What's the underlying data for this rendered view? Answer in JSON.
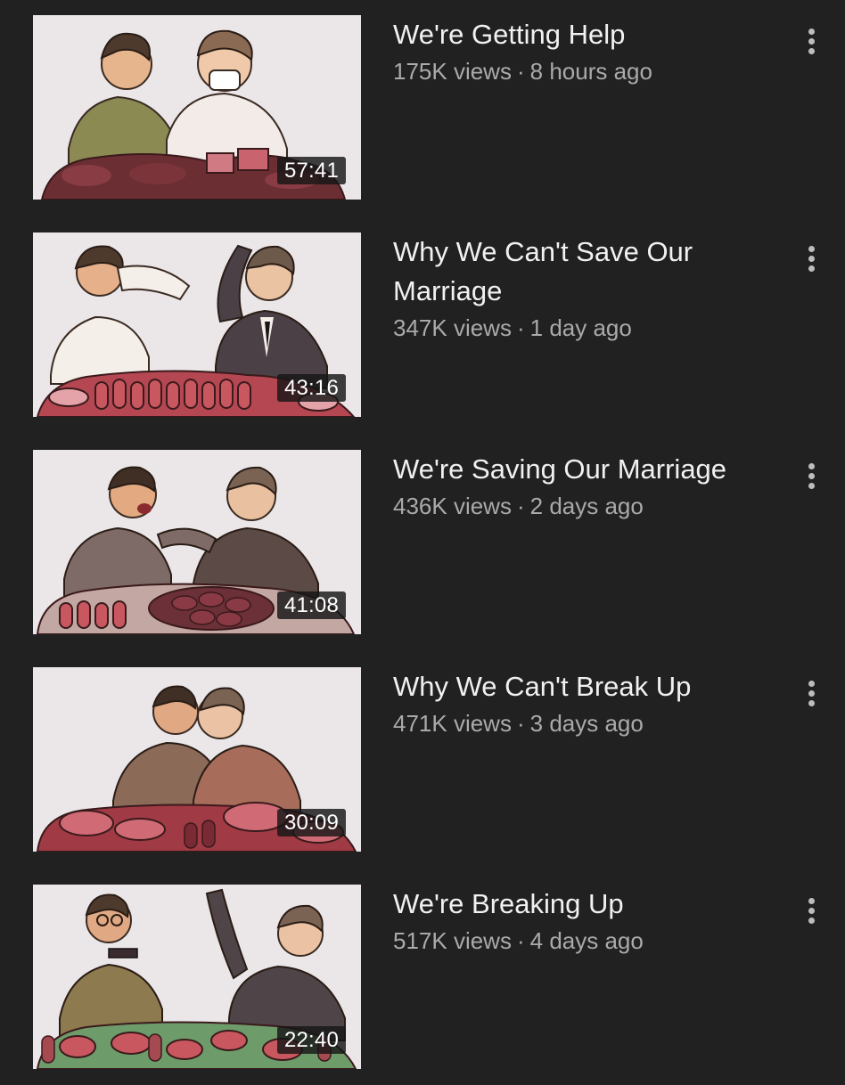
{
  "videos": [
    {
      "title": "We're Getting Help",
      "views": "175K views",
      "separator": "·",
      "age": "8 hours ago",
      "duration": "57:41"
    },
    {
      "title": "Why We Can't Save Our Marriage",
      "views": "347K views",
      "separator": "·",
      "age": "1 day ago",
      "duration": "43:16"
    },
    {
      "title": "We're Saving Our Marriage",
      "views": "436K views",
      "separator": "·",
      "age": "2 days ago",
      "duration": "41:08"
    },
    {
      "title": "Why We Can't Break Up",
      "views": "471K views",
      "separator": "·",
      "age": "3 days ago",
      "duration": "30:09"
    },
    {
      "title": "We're Breaking Up",
      "views": "517K views",
      "separator": "·",
      "age": "4 days ago",
      "duration": "22:40"
    }
  ],
  "icons": {
    "more": "more-vert-icon"
  },
  "colors": {
    "background": "#212121",
    "title": "#f1f1f1",
    "meta": "#aaaaaa",
    "duration_bg": "#161616"
  }
}
